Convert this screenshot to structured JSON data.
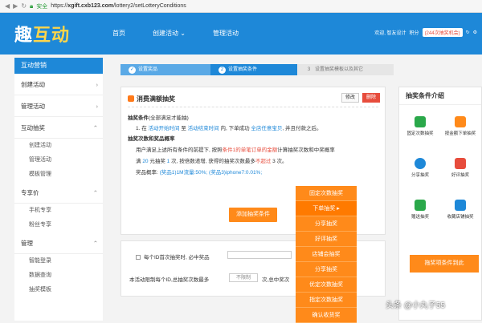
{
  "browser": {
    "secure_label": "安全",
    "url_prefix": "https://",
    "url_host": "xgift.cxb123.com",
    "url_path": "/lottery2/setLotteryConditions"
  },
  "nav": {
    "logo_a": "趣",
    "logo_b": "互动",
    "items": [
      "首页",
      "创建活动 ⌄",
      "管理活动"
    ],
    "user": "欢迎, 智友设计",
    "credit_label": "积分",
    "credit_amount": "(244次抽奖机会)"
  },
  "sidebar": {
    "head": "互动营销",
    "items": [
      {
        "label": "创建活动",
        "arrow": "›"
      },
      {
        "label": "管理活动",
        "arrow": "›"
      },
      {
        "label": "互动抽奖",
        "arrow": "⌃"
      }
    ],
    "sub1": [
      "创建活动",
      "管理活动",
      "模板管理"
    ],
    "item4": {
      "label": "专享价",
      "arrow": "⌃"
    },
    "sub2": [
      "手机专享",
      "粉丝专享"
    ],
    "item5": {
      "label": "管理",
      "arrow": "⌃"
    },
    "sub3": [
      "智能登录",
      "数据查询",
      "抽奖模板"
    ]
  },
  "steps": [
    {
      "num": "✓",
      "label": "设置奖品"
    },
    {
      "num": "2",
      "label": "设置抽奖条件"
    },
    {
      "num": "3",
      "label": "设置抽奖模板以及其它"
    }
  ],
  "card": {
    "title": "消费满额抽奖",
    "edit": "修改",
    "delete": "删除",
    "cond_head": "抽奖条件",
    "cond_note": "(全部满足才能抽)",
    "cond1_a": "1. 在 ",
    "cond1_b": "活动开始时间",
    "cond1_c": " 至 ",
    "cond1_d": "活动结束时间",
    "cond1_e": " 内, 下单成功 ",
    "cond1_f": "全店任意宝贝",
    "cond1_g": ", 并且付款之后。",
    "rule_head": "抽奖次数和奖品概率",
    "rule1_a": "用户满足上述所有条件的前提下, 按照",
    "rule1_b": "条件1的单笔订单的金额",
    "rule1_c": "计算抽奖次数和中奖概率",
    "rule2_a": "满 ",
    "rule2_b": "20",
    "rule2_c": " 元抽奖 ",
    "rule2_d": "1",
    "rule2_e": " 次, 按倍数递增, 获得的抽奖次数最多",
    "rule2_f": "不超过",
    "rule2_g": " 3 次。",
    "prob_a": "奖品概率: ",
    "prob_b": "(奖品1)1M流量:50%; (奖品3)iphone7:0.01%;",
    "add_btn": "添加抽奖条件"
  },
  "card2": {
    "once_label": "每个ID首次抽奖时, 必中奖品",
    "limit_label": "本活动限制每个ID,总抽奖次数最多",
    "limit_value": "不限制",
    "limit_suffix": "次,总中奖次"
  },
  "right": {
    "title": "抽奖条件介绍",
    "tiles": [
      "固定次数抽奖",
      "按金额下单抽奖",
      "分享抽奖",
      "好评抽奖",
      "赠送抽奖",
      "收藏店铺抽奖"
    ]
  },
  "dropdown": [
    "固定次数抽奖",
    "下单抽奖 ▸",
    "分享抽奖",
    "好评抽奖",
    "店铺会抽奖",
    "分享抽奖",
    "优定次数抽奖",
    "指定次数抽奖",
    "确认收货奖"
  ],
  "drag_target": "拖奖项条件到此",
  "watermark": "头条 @小丸子55"
}
